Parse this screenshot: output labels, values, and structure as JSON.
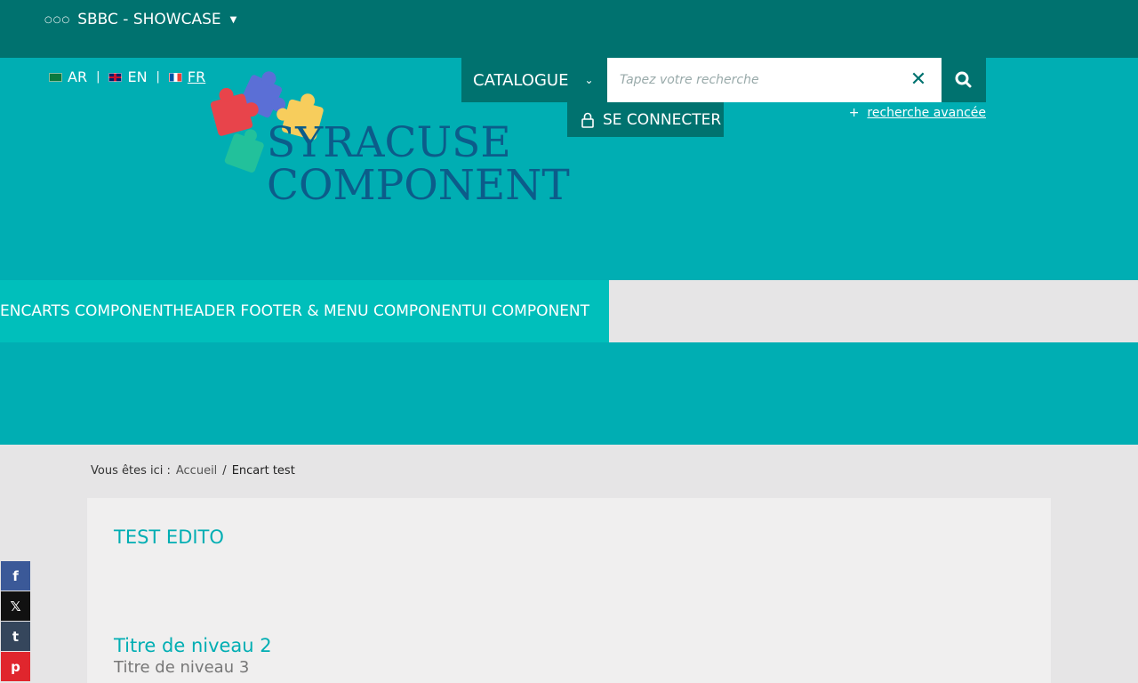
{
  "topbar": {
    "site_name": "SBBC - SHOWCASE"
  },
  "languages": [
    {
      "code": "AR",
      "flag": "flag-ar-icon",
      "active": false
    },
    {
      "code": "EN",
      "flag": "flag-en-icon",
      "active": false
    },
    {
      "code": "FR",
      "flag": "flag-fr-icon",
      "active": true
    }
  ],
  "header": {
    "catalogue_label": "CATALOGUE",
    "search_placeholder": "Tapez votre recherche",
    "login_label": "SE CONNECTER",
    "advanced_search_prefix": "+",
    "advanced_search_label": "recherche avancée"
  },
  "logo": {
    "line1": "SYRACUSE",
    "line2": "COMPONENT"
  },
  "nav": {
    "items": [
      "ENCARTS COMPONENT",
      "HEADER FOOTER & MENU COMPONENT",
      "UI COMPONENT"
    ]
  },
  "breadcrumb": {
    "prefix": "Vous êtes ici :",
    "home": "Accueil",
    "separator": "/",
    "current": "Encart test"
  },
  "content": {
    "title": "TEST EDITO",
    "heading2": "Titre de niveau 2",
    "heading3": "Titre de niveau 3"
  },
  "social": [
    {
      "name": "facebook-icon",
      "glyph": "f"
    },
    {
      "name": "x-icon",
      "glyph": "𝕏"
    },
    {
      "name": "tumblr-icon",
      "glyph": "t"
    },
    {
      "name": "pinterest-icon",
      "glyph": "p"
    }
  ],
  "colors": {
    "dark_teal": "#00726f",
    "teal": "#00aeb3",
    "light_teal": "#00bfbb",
    "logo_blue": "#0c5c8a"
  }
}
